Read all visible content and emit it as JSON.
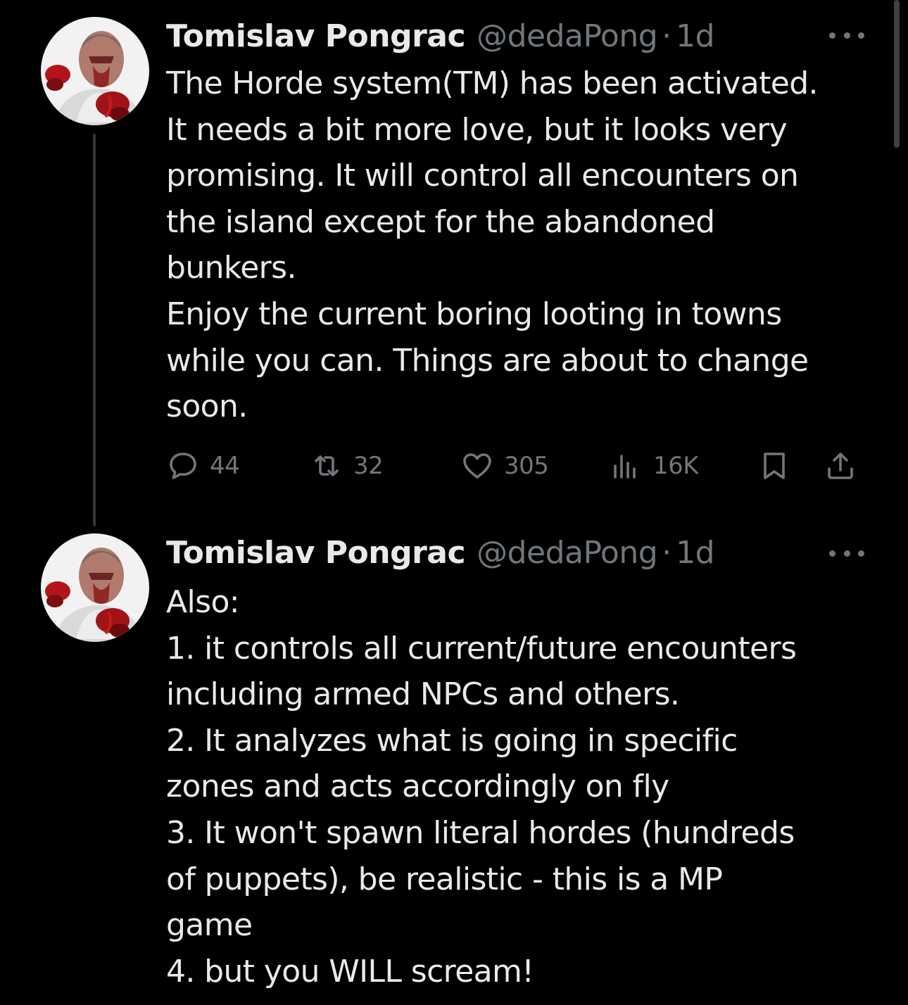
{
  "tweets": [
    {
      "author_name": "Tomislav Pongrac",
      "author_handle": "@dedaPong",
      "separator": "·",
      "time": "1d",
      "lines": [
        "The Horde system(TM) has been activated.",
        "It needs a bit more love, but it looks very",
        "promising. It will control all encounters on",
        "the island except for the abandoned",
        "bunkers.",
        "Enjoy the current boring looting in towns",
        "while you can. Things are about to change",
        "soon."
      ],
      "stats": {
        "replies": "44",
        "retweets": "32",
        "likes": "305",
        "views": "16K"
      }
    },
    {
      "author_name": "Tomislav Pongrac",
      "author_handle": "@dedaPong",
      "separator": "·",
      "time": "1d",
      "lines": [
        "Also:",
        "1. it controls all current/future encounters",
        "including armed NPCs and others.",
        "2. It analyzes what is going in specific",
        "zones and acts accordingly on fly",
        "3. It won't spawn literal hordes (hundreds",
        "of puppets), be realistic - this is a MP",
        "game",
        "4. but you WILL scream!"
      ]
    }
  ],
  "icons": {
    "more": "more-horizontal-icon",
    "reply": "reply-bubble-icon",
    "retweet": "retweet-icon",
    "like": "heart-icon",
    "views": "views-bar-chart-icon",
    "bookmark": "bookmark-icon",
    "share": "share-upload-icon"
  },
  "colors": {
    "background": "#000000",
    "text": "#e7e9ea",
    "secondary": "#71767b",
    "thread_line": "#333639"
  }
}
